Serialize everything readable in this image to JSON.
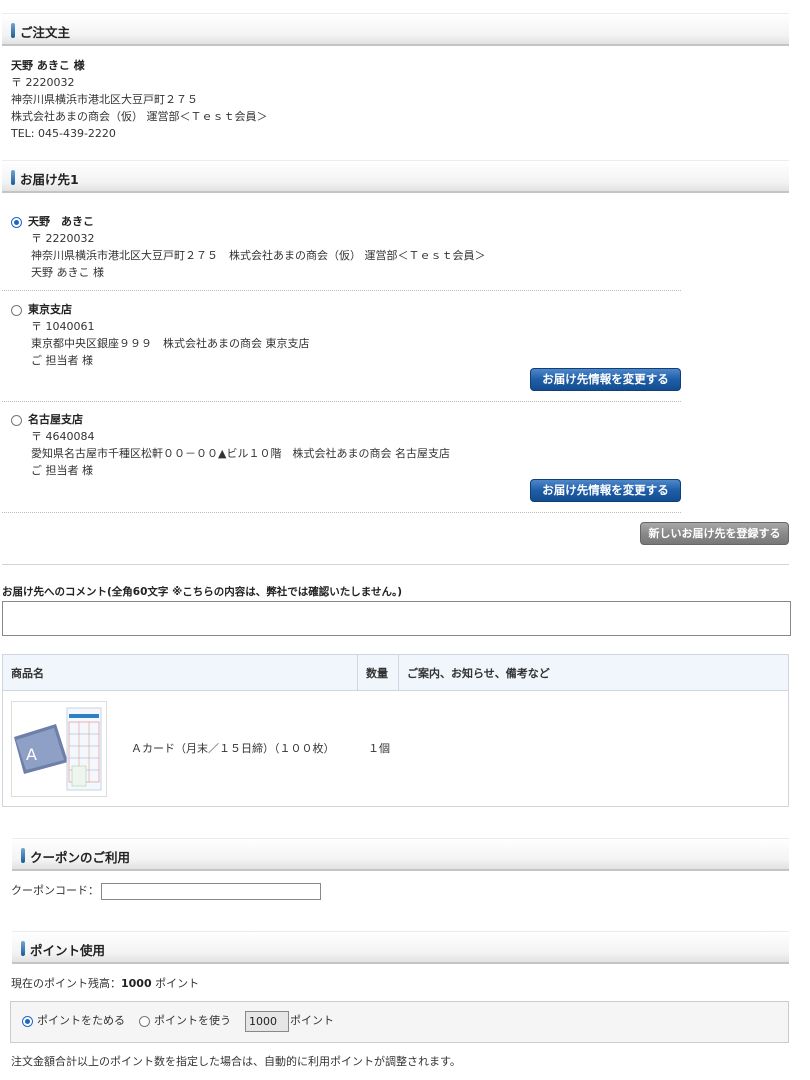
{
  "orderer": {
    "heading": "ご注文主",
    "name": "天野 あきこ 様",
    "zip": "〒 2220032",
    "address": "神奈川県横浜市港北区大豆戸町２７５",
    "company": "株式会社あまの商会（仮） 運営部＜Ｔｅｓｔ会員＞",
    "tel": "TEL: 045-439-2220"
  },
  "delivery": {
    "heading": "お届け先1",
    "options": [
      {
        "name": "天野　あきこ",
        "zip": "〒 2220032",
        "address": "神奈川県横浜市港北区大豆戸町２７５　株式会社あまの商会（仮） 運営部＜Ｔｅｓｔ会員＞",
        "person": "天野 あきこ 様",
        "selected": true
      },
      {
        "name": "東京支店",
        "zip": "〒 1040061",
        "address": "東京都中央区銀座９９９　株式会社あまの商会 東京支店",
        "person": "ご 担当者 様",
        "selected": false,
        "edit_label": "お届け先情報を変更する"
      },
      {
        "name": "名古屋支店",
        "zip": "〒 4640084",
        "address": "愛知県名古屋市千種区松軒００－００▲ビル１０階　株式会社あまの商会 名古屋支店",
        "person": "ご 担当者 様",
        "selected": false,
        "edit_label": "お届け先情報を変更する"
      }
    ],
    "new_address_label": "新しいお届け先を登録する"
  },
  "comment": {
    "label": "お届け先へのコメント(全角60文字 ※こちらの内容は、弊社では確認いたしません。)",
    "value": ""
  },
  "items_table": {
    "headers": [
      "商品名",
      "数量",
      "ご案内、お知らせ、備考など"
    ],
    "rows": [
      {
        "name": "Ａカード（月末／１５日締）（１００枚）",
        "quantity": "１個",
        "note": ""
      }
    ]
  },
  "coupon": {
    "heading": "クーポンのご利用",
    "label": "クーポンコード：",
    "value": ""
  },
  "points": {
    "heading": "ポイント使用",
    "balance_label": "現在のポイント残高：",
    "balance_value": "1000",
    "balance_unit": "ポイント",
    "option_save": "ポイントをためる",
    "option_use": "ポイントを使う",
    "use_value": "1000",
    "use_unit": "ポイント",
    "note": "注文金額合計以上のポイント数を指定した場合は、自動的に利用ポイントが調整されます。"
  },
  "colors": {
    "accent_blue": "#1e5ea7",
    "header_bg": "#f0f6fb"
  }
}
